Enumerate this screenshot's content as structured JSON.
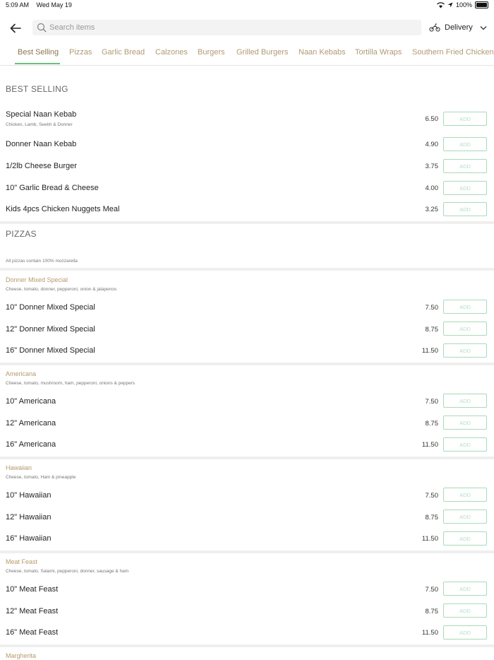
{
  "status": {
    "time": "5:09 AM",
    "date": "Wed May 19",
    "battery": "100%"
  },
  "header": {
    "search_placeholder": "Search items",
    "delivery_label": "Delivery"
  },
  "tabs": [
    "Best Selling",
    "Pizzas",
    "Garlic Bread",
    "Calzones",
    "Burgers",
    "Grilled Burgers",
    "Naan Kebabs",
    "Tortilla Wraps",
    "Southern Fried Chicken"
  ],
  "add_label": "ADD",
  "best_selling": {
    "title": "BEST SELLING",
    "items": [
      {
        "name": "Special Naan Kebab",
        "desc": "Chicken, Lamb, Seekh & Donner",
        "price": "6.50"
      },
      {
        "name": "Donner Naan Kebab",
        "price": "4.90"
      },
      {
        "name": "1/2lb Cheese Burger",
        "price": "3.75"
      },
      {
        "name": "10\" Garlic Bread & Cheese",
        "price": "4.00"
      },
      {
        "name": "Kids 4pcs Chicken Nuggets Meal",
        "price": "3.25"
      }
    ]
  },
  "pizzas": {
    "title": "PIZZAS",
    "note": "All pizzas contain 100% mozzarella",
    "groups": [
      {
        "title": "Donner Mixed Special",
        "desc": "Cheese, tomato, donner, pepperoni, onion & jalapenos",
        "items": [
          {
            "name": "10\" Donner Mixed Special",
            "price": "7.50"
          },
          {
            "name": "12\" Donner Mixed Special",
            "price": "8.75"
          },
          {
            "name": "16\" Donner Mixed Special",
            "price": "11.50"
          }
        ]
      },
      {
        "title": "Americana",
        "desc": "Cheese, tomato, mushroom, ham, pepperoni, onions & peppers",
        "items": [
          {
            "name": "10\" Americana",
            "price": "7.50"
          },
          {
            "name": "12\" Americana",
            "price": "8.75"
          },
          {
            "name": "16\" Americana",
            "price": "11.50"
          }
        ]
      },
      {
        "title": "Hawaiian",
        "desc": "Cheese, tomato, Ham & pineapple",
        "items": [
          {
            "name": "10\" Hawaiian",
            "price": "7.50"
          },
          {
            "name": "12\" Hawaiian",
            "price": "8.75"
          },
          {
            "name": "16\" Hawaiian",
            "price": "11.50"
          }
        ]
      },
      {
        "title": "Meat Feast",
        "desc": "Cheese, tomato, Salami, pepperoni, donner, sausage & ham",
        "items": [
          {
            "name": "10\" Meat Feast",
            "price": "7.50"
          },
          {
            "name": "12\" Meat Feast",
            "price": "8.75"
          },
          {
            "name": "16\" Meat Feast",
            "price": "11.50"
          }
        ]
      },
      {
        "title": "Margherita"
      }
    ]
  }
}
